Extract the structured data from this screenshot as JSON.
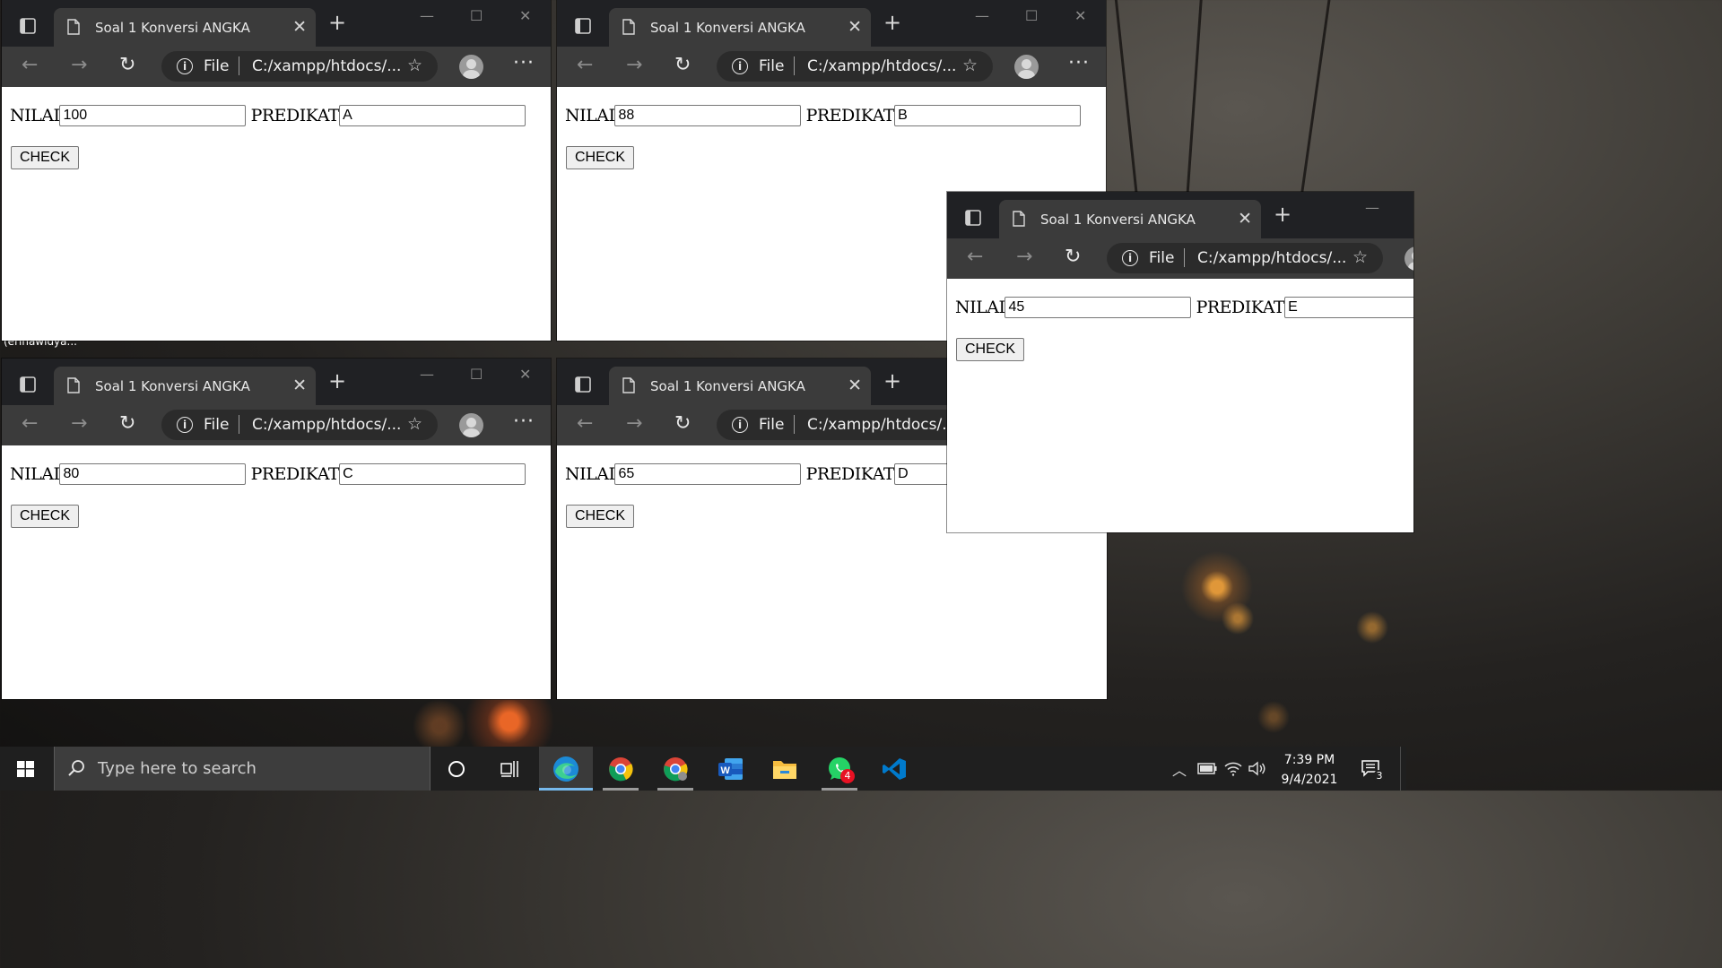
{
  "windows": [
    {
      "tab_title": "Soal 1 Konversi ANGKA",
      "addr_prefix": "File",
      "url": "C:/xampp/htdocs/...",
      "form": {
        "nilai_label": "NILAI",
        "nilai_value": "100",
        "predikat_label": "PREDIKAT",
        "predikat_value": "A",
        "check_label": "CHECK"
      }
    },
    {
      "tab_title": "Soal 1 Konversi ANGKA",
      "addr_prefix": "File",
      "url": "C:/xampp/htdocs/...",
      "form": {
        "nilai_label": "NILAI",
        "nilai_value": "88",
        "predikat_label": "PREDIKAT",
        "predikat_value": "B",
        "check_label": "CHECK"
      }
    },
    {
      "tab_title": "Soal 1 Konversi ANGKA",
      "addr_prefix": "File",
      "url": "C:/xampp/htdocs/...",
      "form": {
        "nilai_label": "NILAI",
        "nilai_value": "80",
        "predikat_label": "PREDIKAT",
        "predikat_value": "C",
        "check_label": "CHECK"
      }
    },
    {
      "tab_title": "Soal 1 Konversi ANGKA",
      "addr_prefix": "File",
      "url": "C:/xampp/htdocs/...",
      "form": {
        "nilai_label": "NILAI",
        "nilai_value": "65",
        "predikat_label": "PREDIKAT",
        "predikat_value": "D",
        "check_label": "CHECK"
      }
    },
    {
      "tab_title": "Soal 1 Konversi ANGKA",
      "addr_prefix": "File",
      "url": "C:/xampp/htdocs/...",
      "form": {
        "nilai_label": "NILAI",
        "nilai_value": "45",
        "predikat_label": "PREDIKAT",
        "predikat_value": "E",
        "check_label": "CHECK"
      }
    }
  ],
  "desktop_label": "(erinawidya...",
  "taskbar": {
    "search_placeholder": "Type here to search",
    "apps": [
      "edge-icon",
      "chrome-icon",
      "chrome-profile-icon",
      "word-icon",
      "file-explorer-icon",
      "whatsapp-icon",
      "vscode-icon"
    ],
    "whatsapp_badge": "4",
    "clock_time": "7:39 PM",
    "clock_date": "9/4/2021",
    "notification_count": "3"
  },
  "colors": {
    "tab_bar": "#202124",
    "toolbar": "#3b3b3b",
    "taskbar": "#1f1f1f",
    "accent": "#76b9ed"
  }
}
